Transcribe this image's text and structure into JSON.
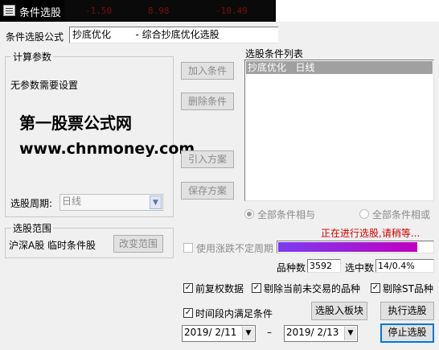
{
  "window": {
    "title": "条件选股",
    "ticker": [
      "-1.50",
      "8.98",
      "-10.49"
    ]
  },
  "formula": {
    "label": "条件选股公式",
    "value": "抄底优化        - 综合抄底优化选股"
  },
  "calc_params": {
    "title": "计算参数",
    "text": "无参数需要设置"
  },
  "watermark": {
    "line1": "第一股票公式网",
    "line2": "www.chnmoney.com"
  },
  "period": {
    "label": "选股周期:",
    "value": "日线"
  },
  "buttons": {
    "add": "加入条件",
    "delete": "删除条件",
    "import": "引入方案",
    "save": "保存方案",
    "change_range": "改变范围",
    "to_block": "选股入板块",
    "execute": "执行选股",
    "stop": "停止选股"
  },
  "condition_list": {
    "title": "选股条件列表",
    "items": [
      "抄底优化   日线"
    ]
  },
  "logic": {
    "and_label": "全部条件相与",
    "or_label": "全部条件相或"
  },
  "progress": {
    "status": "正在进行选股,请稍等...",
    "fraction": 0.9,
    "color_start": "#7b3cf0",
    "color_end": "#c000c0"
  },
  "scope": {
    "title": "选股范围",
    "value": "沪深A股 临时条件股"
  },
  "volatile_period": {
    "label": "使用涨跌不定周期",
    "checked": false
  },
  "stats": {
    "count_label": "品种数",
    "count_value": "3592",
    "selected_label": "选中数",
    "selected_value": "14/0.4%"
  },
  "options": {
    "prev_adjust": "前复权数据",
    "exclude_no_trade": "剔除当前未交易的品种",
    "exclude_st": "剔除ST品种",
    "time_range": "时间段内满足条件"
  },
  "dates": {
    "start": "2019/ 2/11",
    "dash": "–",
    "end": "2019/ 2/13"
  }
}
